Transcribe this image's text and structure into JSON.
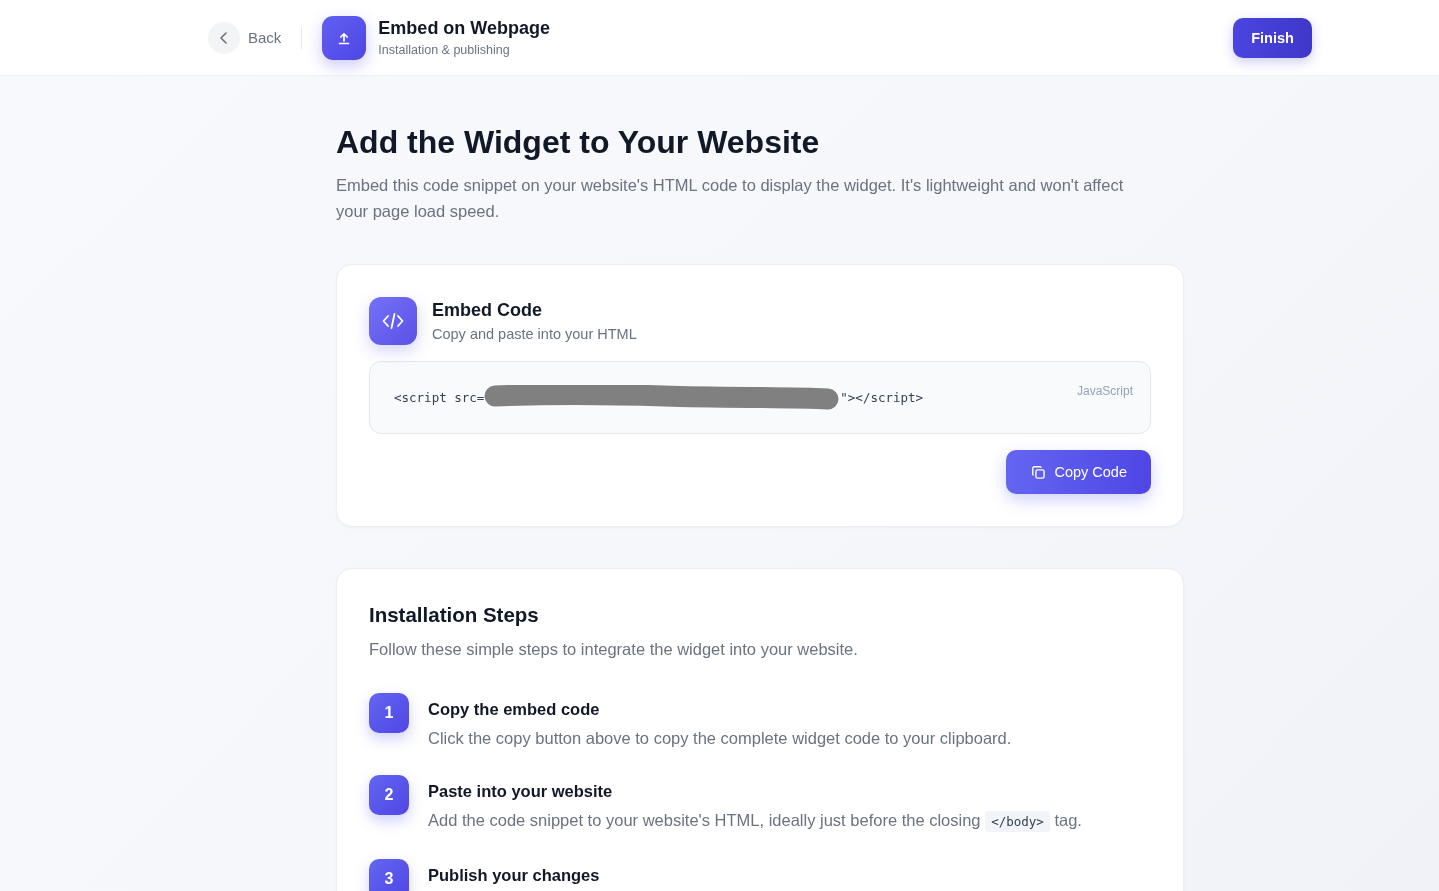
{
  "header": {
    "back_label": "Back",
    "title": "Embed on Webpage",
    "subtitle": "Installation & publishing",
    "finish_label": "Finish"
  },
  "intro": {
    "title": "Add the Widget to Your Website",
    "description": "Embed this code snippet on your website's HTML code to display the widget. It's lightweight and won't affect your page load speed."
  },
  "embed_card": {
    "title": "Embed Code",
    "subtitle": "Copy and paste into your HTML",
    "code": {
      "before": "<script src=",
      "redacted": true,
      "after": "\"></script>",
      "language": "JavaScript"
    },
    "copy_label": "Copy Code"
  },
  "steps_card": {
    "title": "Installation Steps",
    "description": "Follow these simple steps to integrate the widget into your website.",
    "steps": [
      {
        "number": "1",
        "title": "Copy the embed code",
        "description": [
          {
            "kind": "text",
            "text": "Click the copy button above to copy the complete widget code to your clipboard."
          }
        ]
      },
      {
        "number": "2",
        "title": "Paste into your website",
        "description": [
          {
            "kind": "text",
            "text": "Add the code snippet to your website's HTML, ideally just before the closing "
          },
          {
            "kind": "code",
            "text": "</body>"
          },
          {
            "kind": "text",
            "text": " tag."
          }
        ]
      },
      {
        "number": "3",
        "title": "Publish your changes"
      }
    ]
  }
}
